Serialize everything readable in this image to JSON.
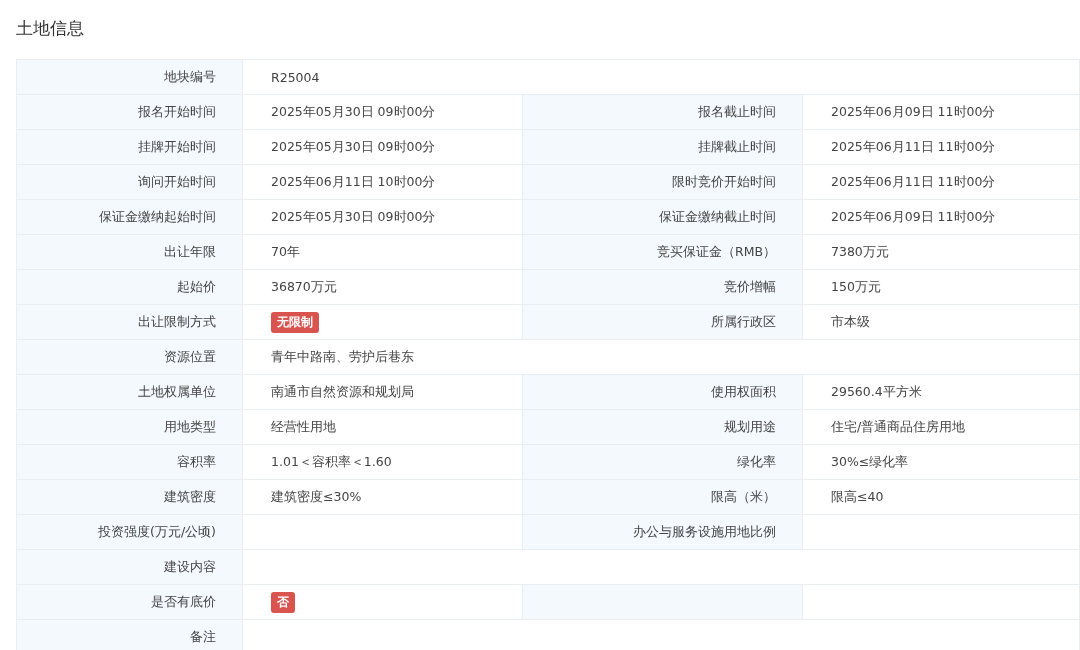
{
  "title": "土地信息",
  "rows": [
    {
      "label": "地块编号",
      "value": "R25004",
      "kind": "text",
      "wide": true
    },
    {
      "label": "报名开始时间",
      "value": "2025年05月30日 09时00分",
      "kind": "text",
      "wide": false,
      "label_2": "报名截止时间",
      "value_2": "2025年06月09日 11时00分"
    },
    {
      "label": "挂牌开始时间",
      "value": "2025年05月30日 09时00分",
      "kind": "text",
      "wide": false,
      "label_2": "挂牌截止时间",
      "value_2": "2025年06月11日 11时00分"
    },
    {
      "label": "询问开始时间",
      "value": "2025年06月11日 10时00分",
      "kind": "text",
      "wide": false,
      "label_2": "限时竞价开始时间",
      "value_2": "2025年06月11日 11时00分"
    },
    {
      "label": "保证金缴纳起始时间",
      "value": "2025年05月30日 09时00分",
      "kind": "text",
      "wide": false,
      "label_2": "保证金缴纳截止时间",
      "value_2": "2025年06月09日 11时00分"
    },
    {
      "label": "出让年限",
      "value": "70年",
      "kind": "text",
      "wide": false,
      "label_2": "竞买保证金（RMB）",
      "value_2": "7380万元"
    },
    {
      "label": "起始价",
      "value": "36870万元",
      "kind": "text",
      "wide": false,
      "label_2": "竞价增幅",
      "value_2": "150万元"
    },
    {
      "label": "出让限制方式",
      "value": "无限制",
      "kind": "tag",
      "wide": false,
      "label_2": "所属行政区",
      "value_2": "市本级"
    },
    {
      "label": "资源位置",
      "value": "青年中路南、劳护后巷东",
      "kind": "text",
      "wide": true
    },
    {
      "label": "土地权属单位",
      "value": "南通市自然资源和规划局",
      "kind": "text",
      "wide": false,
      "label_2": "使用权面积",
      "value_2": "29560.4平方米"
    },
    {
      "label": "用地类型",
      "value": "经营性用地",
      "kind": "text",
      "wide": false,
      "label_2": "规划用途",
      "value_2": "住宅/普通商品住房用地"
    },
    {
      "label": "容积率",
      "value": "1.01＜容积率＜1.60",
      "kind": "text",
      "wide": false,
      "label_2": "绿化率",
      "value_2": "30%≤绿化率"
    },
    {
      "label": "建筑密度",
      "value": "建筑密度≤30%",
      "kind": "text",
      "wide": false,
      "label_2": "限高（米）",
      "value_2": "限高≤40"
    },
    {
      "label": "投资强度(万元/公顷)",
      "wide": false,
      "label_2": "办公与服务设施用地比例"
    },
    {
      "label": "建设内容",
      "wide": true
    },
    {
      "label": "是否有底价",
      "value": "否",
      "kind": "tag",
      "wide": false
    },
    {
      "label": "备注",
      "wide": true
    }
  ]
}
